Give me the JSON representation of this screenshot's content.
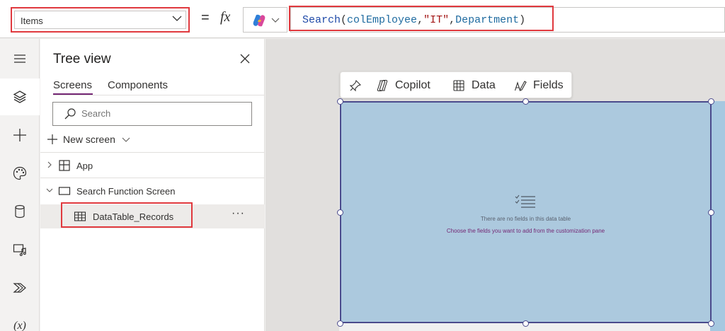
{
  "formula_bar": {
    "property": "Items",
    "equals": "=",
    "fx": "fx",
    "formula": {
      "fn": "Search",
      "open": "(",
      "arg1": "colEmployee",
      "comma1": ",",
      "arg2": "\"IT\"",
      "comma2": ",",
      "arg3": "Department",
      "close": ")"
    }
  },
  "rail": {
    "items": [
      "menu-icon",
      "layers-icon",
      "plus-icon",
      "palette-icon",
      "database-icon",
      "media-icon",
      "automate-icon",
      "variables-icon"
    ],
    "active_index": 1,
    "variables_label": "(x)"
  },
  "tree_view": {
    "title": "Tree view",
    "tabs": {
      "screens": "Screens",
      "components": "Components"
    },
    "search_placeholder": "Search",
    "new_screen": "New screen",
    "nodes": {
      "app": "App",
      "screen": "Search Function Screen",
      "control": "DataTable_Records"
    },
    "more": "···"
  },
  "canvas": {
    "toolbar": {
      "copilot": "Copilot",
      "data": "Data",
      "fields": "Fields"
    },
    "empty_title": "There are no fields in this data table",
    "empty_hint": "Choose the fields you want to add from the customization pane"
  },
  "colors": {
    "highlight": "#e0393e",
    "accent": "#742774",
    "table_fill": "#acc9de",
    "table_border": "#4a4a8c"
  }
}
